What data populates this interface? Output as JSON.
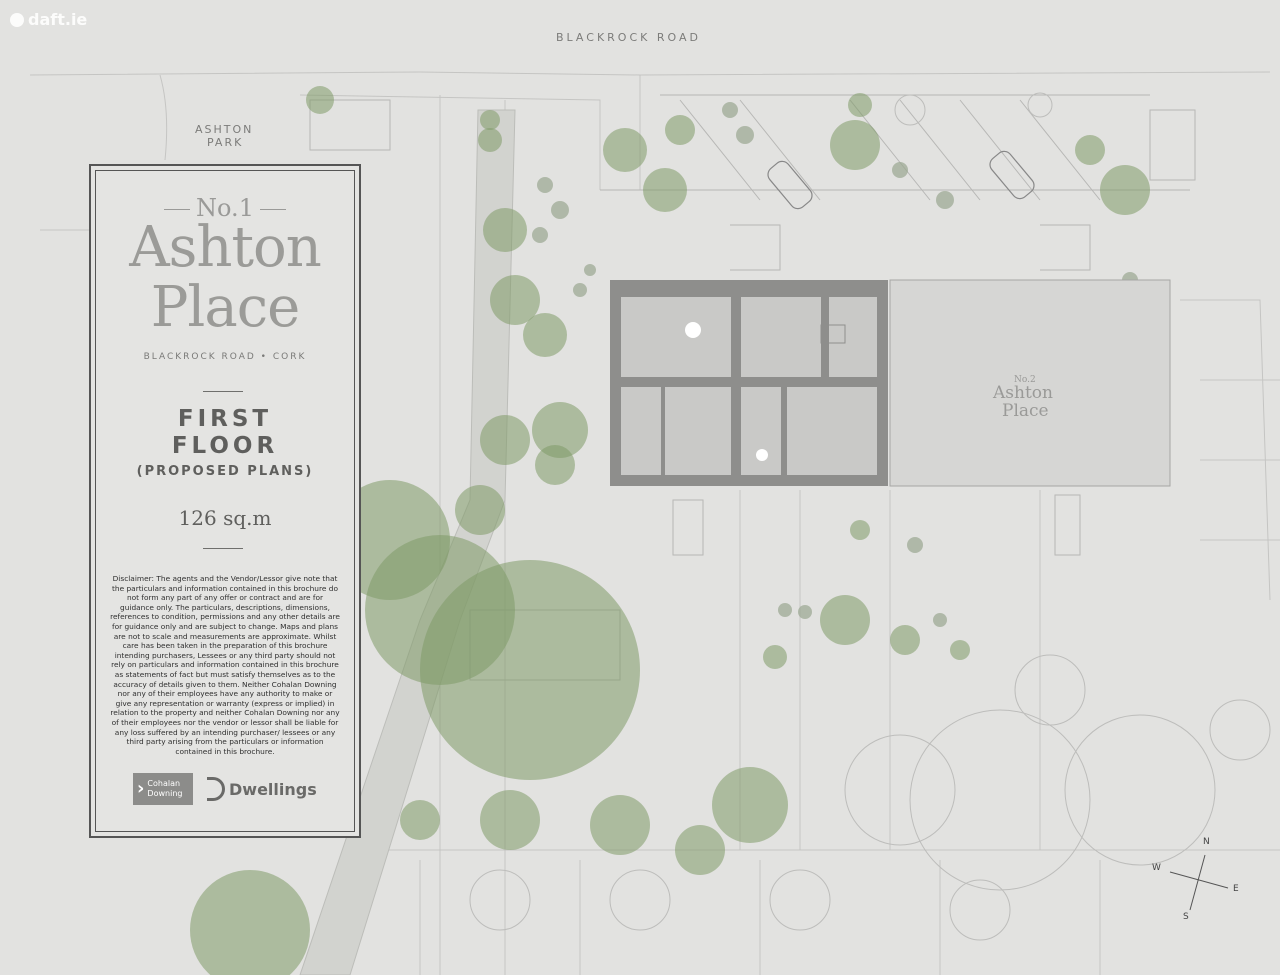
{
  "watermark": {
    "text": "daft.ie"
  },
  "map": {
    "road_label": "BLACKROCK ROAD",
    "park_label_1": "ASHTON",
    "park_label_2": "PARK",
    "neighbour": {
      "no": "No.2",
      "name_1": "Ashton",
      "name_2": "Place"
    },
    "compass": {
      "n": "N",
      "e": "E",
      "s": "S",
      "w": "W"
    }
  },
  "panel": {
    "no": "No.1",
    "title_1": "Ashton",
    "title_2": "Place",
    "address": "BLACKROCK ROAD • CORK",
    "floor_1": "FIRST",
    "floor_2": "FLOOR",
    "proposed": "(PROPOSED PLANS)",
    "area": "126 sq.m",
    "disclaimer": "Disclaimer: The agents and the Vendor/Lessor give note that the particulars and information contained in this brochure do not form any part of any offer or contract and are for guidance only. The particulars, descriptions, dimensions, references to condition, permissions and any other details are for guidance only and are subject to change. Maps and plans are not to scale and measurements are approximate. Whilst care has been taken in the preparation of this brochure intending purchasers, Lessees or any third party should not rely on particulars and information contained in this brochure as statements of fact but must satisfy themselves as to the accuracy of details given to them. Neither Cohalan Downing nor any of their employees have any authority to make or give any representation or warranty (express or implied) in relation to the property and neither Cohalan Downing nor any of their employees nor the vendor or lessor shall be liable for any loss suffered by an intending purchaser/ lessees or any third party arising from the particulars or information contained in this brochure.",
    "logo_1_line_1": "Cohalan",
    "logo_1_line_2": "Downing",
    "logo_2": "Dwellings"
  },
  "colors": {
    "background": "#e2e2e0",
    "tree": "#7f9a68",
    "wall": "#8e8e8c",
    "room": "#c9c9c7"
  }
}
